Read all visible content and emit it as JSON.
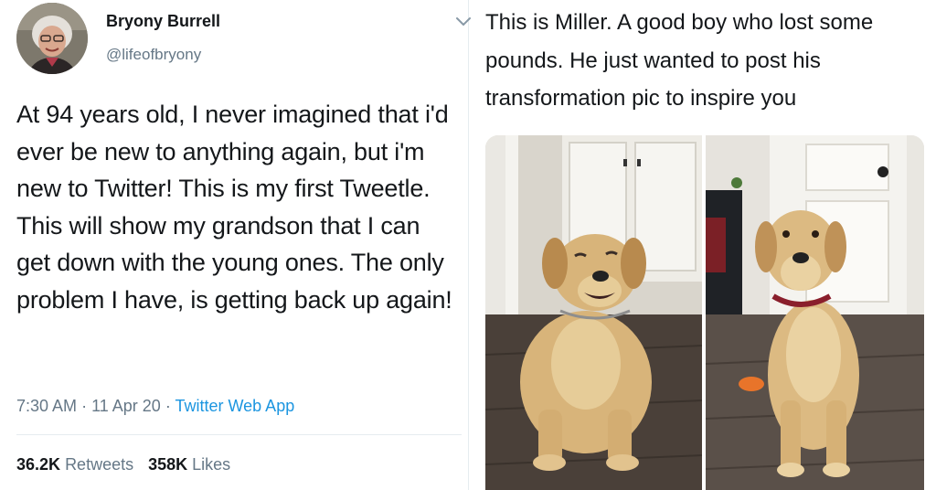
{
  "left_tweet": {
    "display_name": "Bryony Burrell",
    "handle": "@lifeofbryony",
    "text": "At 94 years old, I never imagined that i'd ever be new to anything again, but i'm new to Twitter! This is my first Tweetle. This will show my grandson that I can get down with the young ones. The only problem I have, is getting back up again!",
    "time": "7:30 AM",
    "date": "11 Apr 20",
    "source": "Twitter Web App",
    "retweets_count": "36.2K",
    "retweets_label": "Retweets",
    "likes_count": "358K",
    "likes_label": "Likes"
  },
  "right_tweet": {
    "text": "This is Miller. A good boy who lost some pounds. He just wanted to post his transformation pic to inspire you"
  },
  "colors": {
    "text": "#14171a",
    "secondary": "#657786",
    "link": "#1b95e0",
    "divider": "#e6ecf0"
  }
}
